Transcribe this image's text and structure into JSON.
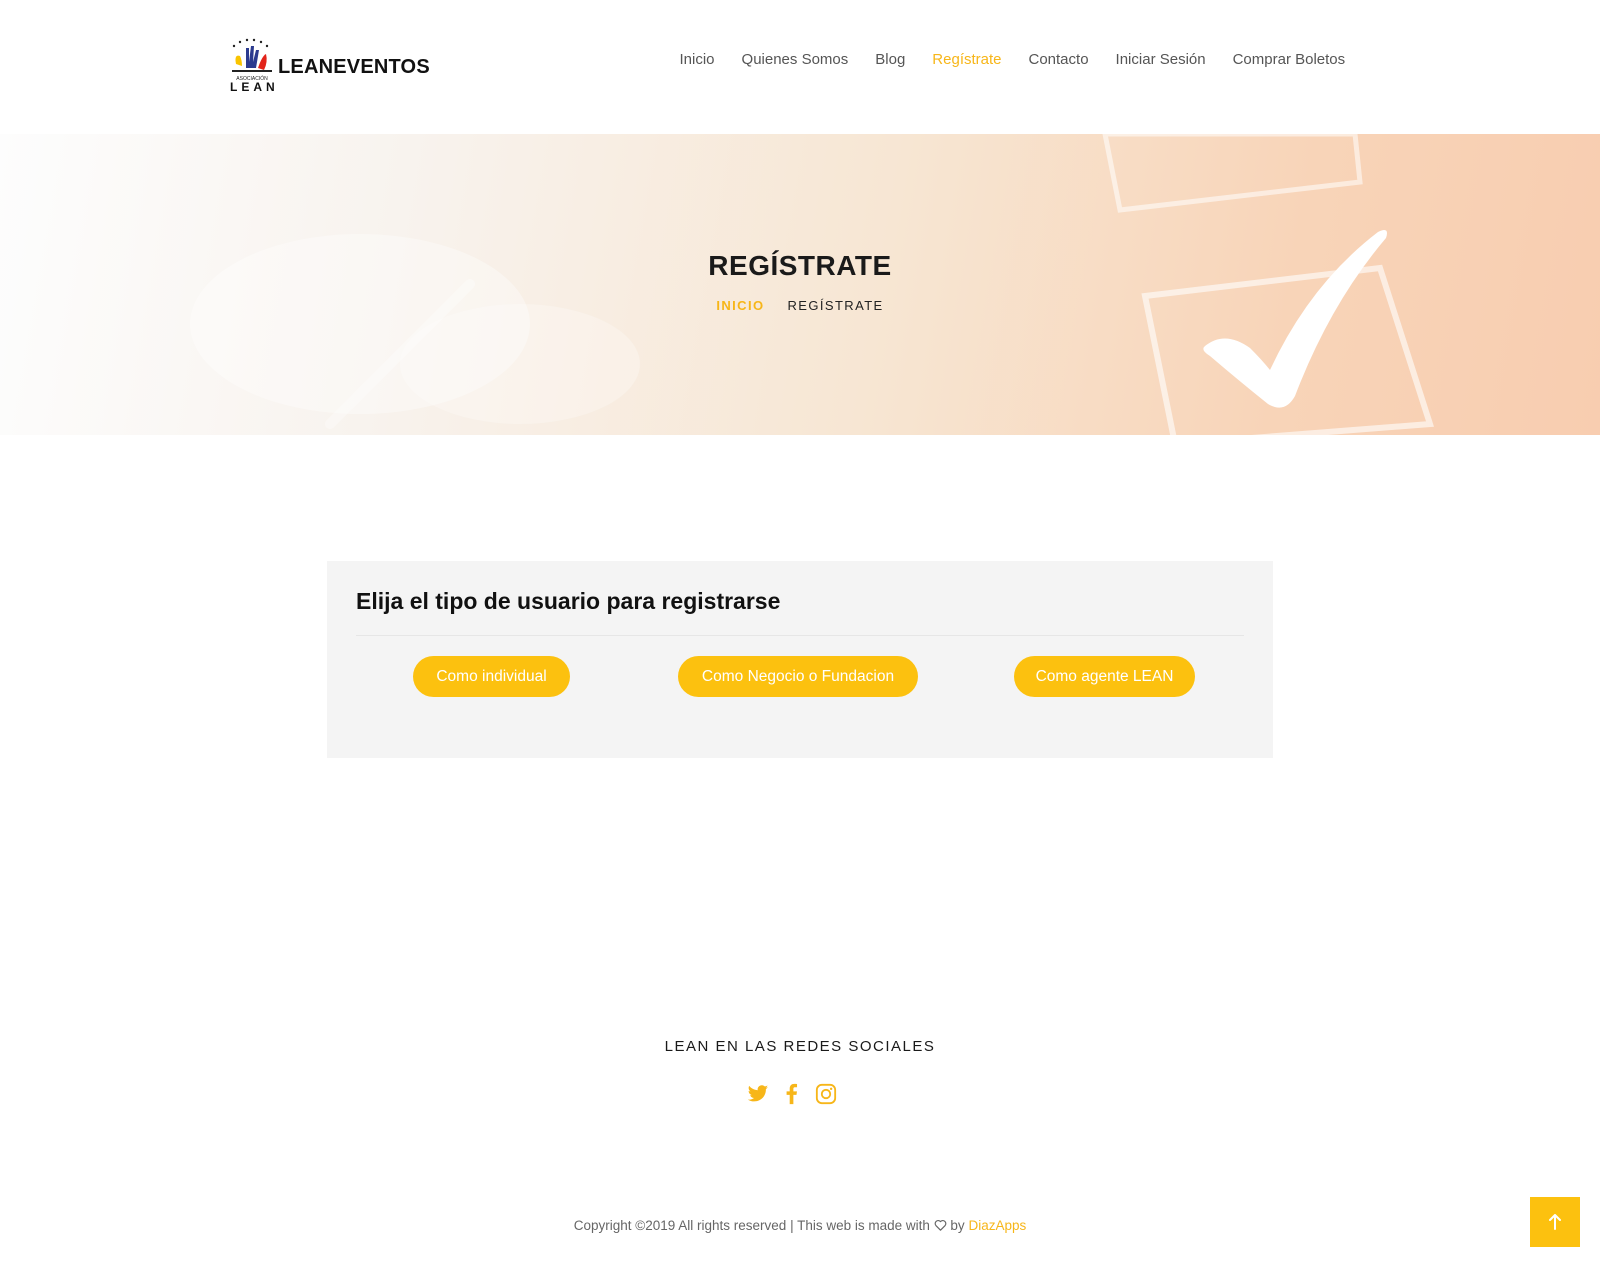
{
  "header": {
    "logo_text": "LEANEVENTOS",
    "logo_subtext": "LEAN",
    "nav": [
      {
        "label": "Inicio",
        "active": false
      },
      {
        "label": "Quienes Somos",
        "active": false
      },
      {
        "label": "Blog",
        "active": false
      },
      {
        "label": "Regístrate",
        "active": true
      },
      {
        "label": "Contacto",
        "active": false
      },
      {
        "label": "Iniciar Sesión",
        "active": false
      },
      {
        "label": "Comprar Boletos",
        "active": false
      }
    ]
  },
  "hero": {
    "title": "REGÍSTRATE",
    "breadcrumb_home": "INICIO",
    "breadcrumb_current": "REGÍSTRATE"
  },
  "registration": {
    "title": "Elija el tipo de usuario para registrarse",
    "buttons": [
      "Como individual",
      "Como Negocio o Fundacion",
      "Como agente LEAN"
    ]
  },
  "footer": {
    "social_title": "LEAN EN LAS REDES SOCIALES",
    "social_icons": [
      "twitter-icon",
      "facebook-icon",
      "instagram-icon"
    ],
    "copyright_prefix": "Copyright ©2019 All rights reserved | This web is made with",
    "copyright_by": "by",
    "copyright_brand": "DiazApps"
  },
  "colors": {
    "accent": "#fcc10f",
    "accent_text": "#f7b619",
    "card_bg": "#f4f4f4"
  }
}
